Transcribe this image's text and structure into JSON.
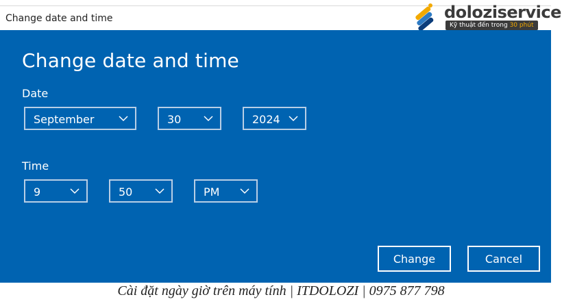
{
  "window": {
    "title": "Change date and time"
  },
  "dialog": {
    "heading": "Change date and time",
    "date_label": "Date",
    "time_label": "Time",
    "month": "September",
    "day": "30",
    "year": "2024",
    "hour": "9",
    "minute": "50",
    "ampm": "PM",
    "change_button": "Change",
    "cancel_button": "Cancel"
  },
  "watermark": {
    "brand": "doloziservice",
    "tagline_prefix": "Kỹ thuật đến trong",
    "tagline_highlight": "30 phút"
  },
  "caption": "Cài đặt ngày giờ trên máy tính | ITDOLOZI | 0975 877 798",
  "colors": {
    "dialog_bg": "#0063b1",
    "text": "#ffffff",
    "border": "#b9cfe6"
  }
}
